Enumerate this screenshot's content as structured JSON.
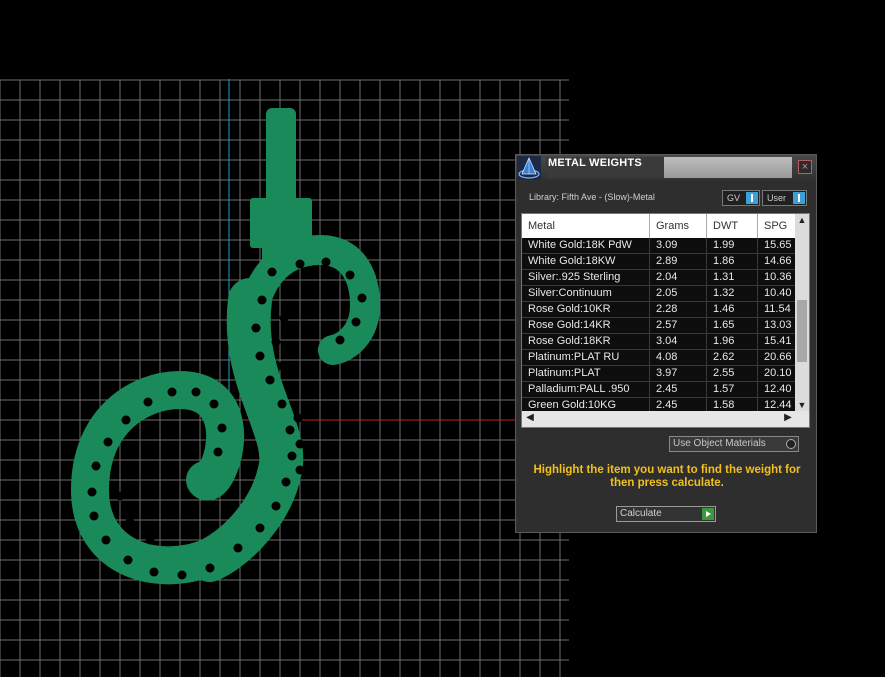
{
  "dialog": {
    "title": "METAL WEIGHTS",
    "close_glyph": "×",
    "library_label": "Library: Fifth Ave - (Slow)-Metal",
    "gv_label": "GV",
    "user_label": "User",
    "columns": [
      "Metal",
      "Grams",
      "DWT",
      "SPG"
    ],
    "rows": [
      [
        "White Gold:18K PdW",
        "3.09",
        "1.99",
        "15.65"
      ],
      [
        "White Gold:18KW",
        "2.89",
        "1.86",
        "14.66"
      ],
      [
        "Silver:.925 Sterling",
        "2.04",
        "1.31",
        "10.36"
      ],
      [
        "Silver:Continuum",
        "2.05",
        "1.32",
        "10.40"
      ],
      [
        "Rose Gold:10KR",
        "2.28",
        "1.46",
        "11.54"
      ],
      [
        "Rose Gold:14KR",
        "2.57",
        "1.65",
        "13.03"
      ],
      [
        "Rose Gold:18KR",
        "3.04",
        "1.96",
        "15.41"
      ],
      [
        "Platinum:PLAT RU",
        "4.08",
        "2.62",
        "20.66"
      ],
      [
        "Platinum:PLAT",
        "3.97",
        "2.55",
        "20.10"
      ],
      [
        "Palladium:PALL .950",
        "2.45",
        "1.57",
        "12.40"
      ],
      [
        "Green Gold:10KG",
        "2.45",
        "1.58",
        "12.44"
      ]
    ],
    "use_object_materials_label": "Use Object Materials",
    "hint_text": "Highlight the item you want to find the weight for then press calculate.",
    "calculate_label": "Calculate",
    "scroll_up": "▲",
    "scroll_down": "▼",
    "scroll_left": "◀",
    "scroll_right": "▶"
  },
  "viewport": {
    "background": "#000000",
    "grid_color": "#6e6e6e",
    "model_color": "#1a8a5a",
    "axis_x_color": "#c02020",
    "axis_y_color": "#2aa0c0"
  }
}
